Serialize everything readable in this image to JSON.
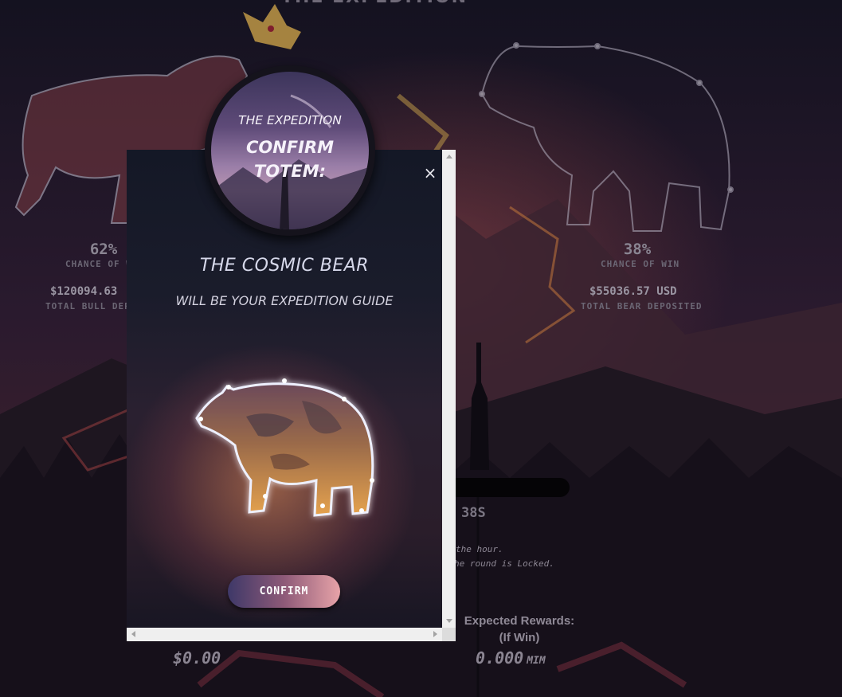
{
  "background": {
    "page_title": "THE EXPEDITION",
    "bull": {
      "chance_percent": "62%",
      "chance_label": "CHANCE OF W",
      "deposited_amount": "$120094.63",
      "deposited_label": "TOTAL BULL DEPOS"
    },
    "bear": {
      "chance_percent": "38%",
      "chance_label": "CHANCE OF WIN",
      "deposited_amount": "$55036.57 USD",
      "deposited_label": "TOTAL BEAR DEPOSITED"
    },
    "timer_fragment": "38S",
    "note_line_1": "the hour.",
    "note_line_2": "he round is Locked.",
    "expected_rewards_label_1": "Expected Rewards:",
    "expected_rewards_label_2": "(If Win)",
    "left_amount": "$0.00",
    "right_amount": "0.000",
    "right_amount_unit": "MIM"
  },
  "modal": {
    "medallion_title": "THE EXPEDITION",
    "medallion_line_1": "CONFIRM",
    "medallion_line_2": "TOTEM:",
    "close_symbol": "×",
    "heading": "THE COSMIC BEAR",
    "subheading": "WILL BE YOUR EXPEDITION GUIDE",
    "confirm_label": "CONFIRM"
  },
  "colors": {
    "accent_gradient_start": "#3e3868",
    "accent_gradient_end": "#e7a3a8",
    "modal_background": "#141826"
  },
  "icons": [
    "close-icon",
    "cosmic-bear-image",
    "bull-constellation-icon",
    "bear-constellation-icon",
    "crown-icon"
  ]
}
